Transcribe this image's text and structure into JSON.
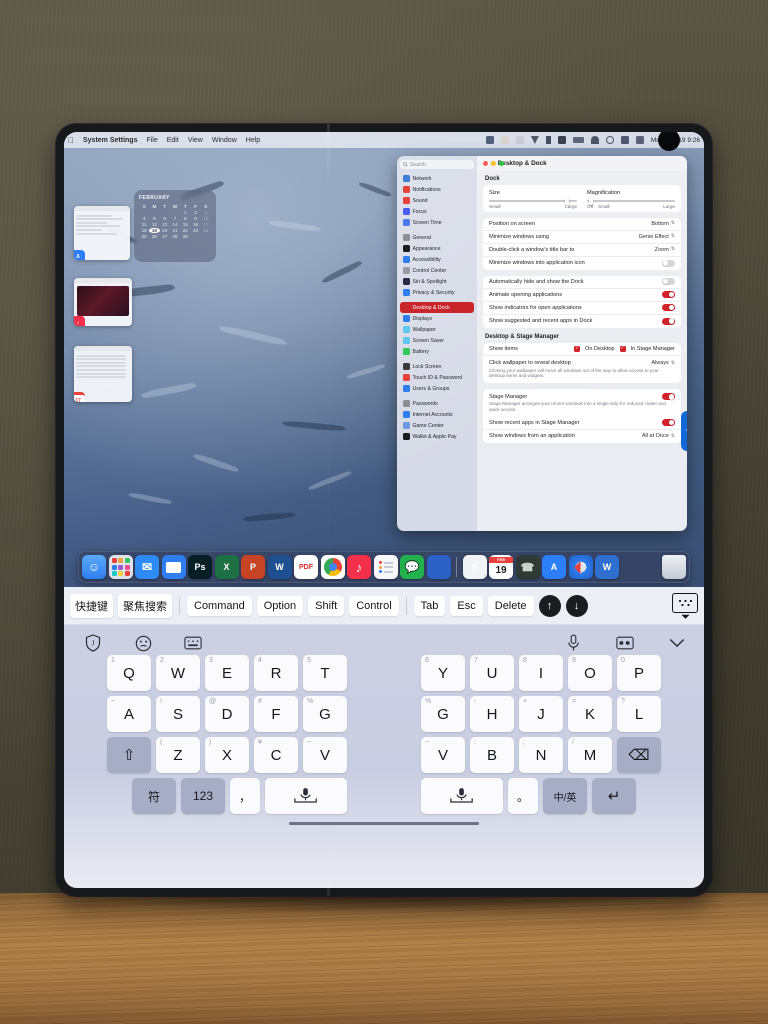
{
  "device": {
    "type": "foldable-phone",
    "surface": "wooden-desk",
    "wall_color": "#514c3c",
    "desk_color": "#a97a44",
    "bezel_color": "#17181a"
  },
  "macos": {
    "accent_color": "#d2232a",
    "wallpaper": "school-of-barracuda-underwater",
    "menubar": {
      "apple_logo": "apple-icon",
      "items": [
        {
          "label": "System Settings",
          "bold": true
        },
        {
          "label": "File",
          "bold": false
        },
        {
          "label": "Edit",
          "bold": false
        },
        {
          "label": "View",
          "bold": false
        },
        {
          "label": "Window",
          "bold": false
        },
        {
          "label": "Help",
          "bold": false
        }
      ],
      "status_icons": [
        "display-icon",
        "dropbox-icon",
        "printer-icon",
        "foxmail-icon",
        "bluetooth-icon",
        "app-icon",
        "battery-icon",
        "wifi-icon",
        "search-icon",
        "input-source-icon",
        "control-center-icon"
      ],
      "clock": "Mon Feb 19  9:26"
    },
    "calendar_widget": {
      "month": "FEBRUARY",
      "dow": [
        "S",
        "M",
        "T",
        "W",
        "T",
        "F",
        "S"
      ],
      "weeks": [
        [
          "",
          "",
          "",
          "",
          "1",
          "2",
          "3"
        ],
        [
          "4",
          "5",
          "6",
          "7",
          "8",
          "9",
          "10"
        ],
        [
          "11",
          "12",
          "13",
          "14",
          "15",
          "16",
          "17"
        ],
        [
          "18",
          "19",
          "20",
          "21",
          "22",
          "23",
          "24"
        ],
        [
          "25",
          "26",
          "27",
          "28",
          "29",
          "",
          ""
        ]
      ],
      "today": "19",
      "dim_days": [
        "3",
        "10",
        "17",
        "24"
      ]
    },
    "stage_manager": [
      {
        "name": "app-store-window",
        "badge": "A",
        "badge_color": "#2d7ff9"
      },
      {
        "name": "music-window",
        "badge": "♪",
        "badge_color": "#f42f4a"
      },
      {
        "name": "calendar-window",
        "badge": "17",
        "badge_color": "#ffffff"
      }
    ],
    "dock": {
      "apps": [
        {
          "name": "finder",
          "label": "",
          "color": "#2f7ef0"
        },
        {
          "name": "launchpad",
          "label": "",
          "color": "#dfe2ea"
        },
        {
          "name": "mail",
          "label": "✉",
          "color": "#2e8bf5"
        },
        {
          "name": "keynote",
          "label": "",
          "color": "#2f7ef0"
        },
        {
          "name": "photoshop",
          "label": "Ps",
          "color": "#061e26"
        },
        {
          "name": "excel",
          "label": "X",
          "color": "#1d7044"
        },
        {
          "name": "powerpoint",
          "label": "P",
          "color": "#c64424"
        },
        {
          "name": "word",
          "label": "W",
          "color": "#1d4f91"
        },
        {
          "name": "pdf-reader",
          "label": "PDF",
          "color": "#d8272c"
        },
        {
          "name": "chrome",
          "label": "",
          "color": "#f5f5f7"
        },
        {
          "name": "music",
          "label": "♪",
          "color": "#f42f4a"
        },
        {
          "name": "reminders",
          "label": "",
          "color": "#f7f7fa"
        },
        {
          "name": "wechat",
          "label": "",
          "color": "#22b14c"
        },
        {
          "name": "activity-app",
          "label": "",
          "color": "#2b60c6"
        }
      ],
      "recent": [
        {
          "name": "foxmail",
          "label": "Y",
          "color": "#f2f3f6"
        },
        {
          "name": "calendar",
          "label": "19",
          "color": "#ffffff"
        },
        {
          "name": "phone",
          "label": "",
          "color": "#2e3a33"
        },
        {
          "name": "app-store",
          "label": "A",
          "color": "#2d7ff9"
        },
        {
          "name": "safari",
          "label": "",
          "color": "#e9eef5"
        },
        {
          "name": "wps-app",
          "label": "W",
          "color": "#2f6fd0"
        }
      ],
      "trash": {
        "name": "trash",
        "label": "",
        "color": "#dfe3ea"
      }
    },
    "settings_window": {
      "title": "Desktop & Dock",
      "traffic_lights": [
        "#ff5f57",
        "#febc2e",
        "#28c840"
      ],
      "back_icon": "chevron-left-icon",
      "forward_icon": "chevron-right-icon",
      "search_placeholder": "Search",
      "sidebar": [
        {
          "label": "Network",
          "color": "#3f7fd6",
          "gap_after": false
        },
        {
          "label": "Notifications",
          "color": "#e8413c",
          "gap_after": false
        },
        {
          "label": "Sound",
          "color": "#e8413c",
          "gap_after": false
        },
        {
          "label": "Focus",
          "color": "#4b5df0",
          "gap_after": false
        },
        {
          "label": "Screen Time",
          "color": "#4b7df0",
          "gap_after": true
        },
        {
          "label": "General",
          "color": "#8e8e93",
          "gap_after": false
        },
        {
          "label": "Appearance",
          "color": "#1c1c1e",
          "gap_after": false
        },
        {
          "label": "Accessibility",
          "color": "#2f7ef0",
          "gap_after": false
        },
        {
          "label": "Control Center",
          "color": "#9a9aa0",
          "gap_after": false
        },
        {
          "label": "Siri & Spotlight",
          "color": "#2a2a46",
          "gap_after": false
        },
        {
          "label": "Privacy & Security",
          "color": "#2f7ef0",
          "gap_after": true
        },
        {
          "label": "Desktop & Dock",
          "color": "#c8262b",
          "active": true,
          "gap_after": false
        },
        {
          "label": "Displays",
          "color": "#2f7ef0",
          "gap_after": false
        },
        {
          "label": "Wallpaper",
          "color": "#5ec8f0",
          "gap_after": false
        },
        {
          "label": "Screen Saver",
          "color": "#5ec8f0",
          "gap_after": false
        },
        {
          "label": "Battery",
          "color": "#34c759",
          "gap_after": true
        },
        {
          "label": "Lock Screen",
          "color": "#3a3a3c",
          "gap_after": false
        },
        {
          "label": "Touch ID & Password",
          "color": "#e8413c",
          "gap_after": false
        },
        {
          "label": "Users & Groups",
          "color": "#2f7ef0",
          "gap_after": true
        },
        {
          "label": "Passwords",
          "color": "#8e8e93",
          "gap_after": false
        },
        {
          "label": "Internet Accounts",
          "color": "#2f7ef0",
          "gap_after": false
        },
        {
          "label": "Game Center",
          "color": "#6d9ae0",
          "gap_after": false
        },
        {
          "label": "Wallet & Apple Pay",
          "color": "#1c1c1e",
          "gap_after": false
        }
      ],
      "dock_section": {
        "title": "Dock",
        "size": {
          "label": "Size",
          "left": "Small",
          "right": "Large",
          "value_pct": 88
        },
        "magnification": {
          "label": "Magnification",
          "off": "Off",
          "left": "Small",
          "right": "Large",
          "value_pct": 4
        },
        "rows": [
          {
            "label": "Position on screen",
            "type": "select",
            "value": "Bottom"
          },
          {
            "label": "Minimize windows using",
            "type": "select",
            "value": "Genie Effect"
          },
          {
            "label": "Double-click a window's title bar to",
            "type": "select",
            "value": "Zoom"
          },
          {
            "label": "Minimize windows into application icon",
            "type": "toggle",
            "on": false
          }
        ],
        "rows2": [
          {
            "label": "Automatically hide and show the Dock",
            "type": "toggle",
            "on": false
          },
          {
            "label": "Animate opening applications",
            "type": "toggle",
            "on": true
          },
          {
            "label": "Show indicators for open applications",
            "type": "toggle",
            "on": true
          },
          {
            "label": "Show suggested and recent apps in Dock",
            "type": "toggle",
            "on": true
          }
        ]
      },
      "stage_section": {
        "title": "Desktop & Stage Manager",
        "show_items": {
          "label": "Show items",
          "checkboxes": [
            {
              "label": "On Desktop",
              "checked": true
            },
            {
              "label": "In Stage Manager",
              "checked": true
            }
          ]
        },
        "click_wallpaper": {
          "label": "Click wallpaper to reveal desktop",
          "value": "Always",
          "description": "Clicking your wallpaper will move all windows out of the way to allow access to your desktop items and widgets."
        },
        "stage_manager": {
          "label": "Stage Manager",
          "on": true,
          "description": "Stage Manager arranges your recent windows into a single strip for reduced clutter and quick access."
        },
        "show_recent": {
          "label": "Show recent apps in Stage Manager",
          "on": true
        },
        "show_windows": {
          "label": "Show windows from an application",
          "value": "All at Once"
        }
      }
    }
  },
  "keyboard": {
    "toolbar": {
      "chinese_keys": [
        "快捷键",
        "聚焦搜索"
      ],
      "modifier_keys": [
        "Command",
        "Option",
        "Shift",
        "Control"
      ],
      "nav_keys": [
        "Tab",
        "Esc",
        "Delete"
      ],
      "arrow_up": "↑",
      "arrow_down": "↓",
      "dismiss_icon": "hide-keyboard-icon"
    },
    "top_icons_left": [
      "jovi-shield-icon",
      "emoji-icon",
      "keyboard-settings-icon"
    ],
    "top_icons_right": [
      "microphone-icon",
      "clipboard-icon",
      "chevron-down-icon"
    ],
    "rows": [
      {
        "left": [
          {
            "key": "Q",
            "sup": "1"
          },
          {
            "key": "W",
            "sup": "2"
          },
          {
            "key": "E",
            "sup": "3"
          },
          {
            "key": "R",
            "sup": "4"
          },
          {
            "key": "T",
            "sup": "5"
          }
        ],
        "right": [
          {
            "key": "Y",
            "sup": "6"
          },
          {
            "key": "U",
            "sup": "7"
          },
          {
            "key": "I",
            "sup": "8"
          },
          {
            "key": "O",
            "sup": "9"
          },
          {
            "key": "P",
            "sup": "0"
          }
        ]
      },
      {
        "left": [
          {
            "key": "A",
            "sup": "~"
          },
          {
            "key": "S",
            "sup": "!"
          },
          {
            "key": "D",
            "sup": "@"
          },
          {
            "key": "F",
            "sup": "#"
          },
          {
            "key": "G",
            "sup": "%"
          }
        ],
        "right": [
          {
            "key": "G",
            "sup": "%"
          },
          {
            "key": "H",
            "sup": "-"
          },
          {
            "key": "J",
            "sup": "+"
          },
          {
            "key": "K",
            "sup": "="
          },
          {
            "key": "L",
            "sup": "?"
          }
        ]
      },
      {
        "left": [
          {
            "key": "⇧",
            "sup": "",
            "fn": true
          },
          {
            "key": "Z",
            "sup": "("
          },
          {
            "key": "X",
            "sup": ")"
          },
          {
            "key": "C",
            "sup": "¥"
          },
          {
            "key": "V",
            "sup": "~"
          }
        ],
        "right": [
          {
            "key": "V",
            "sup": "~"
          },
          {
            "key": "B",
            "sup": ":"
          },
          {
            "key": "N",
            "sup": ";"
          },
          {
            "key": "M",
            "sup": "/"
          },
          {
            "key": "⌫",
            "sup": "",
            "fn": true
          }
        ]
      }
    ],
    "bottom_row": {
      "left": [
        {
          "key": "符",
          "fn": true
        },
        {
          "key": "123",
          "fn": true
        },
        {
          "key": "，",
          "punct": true
        },
        {
          "key": "space-mic-left",
          "space": true
        }
      ],
      "right": [
        {
          "key": "space-mic-right",
          "space": true
        },
        {
          "key": "。",
          "punct": true
        },
        {
          "key": "中/英",
          "fn": true
        },
        {
          "key": "↵",
          "fn": true
        }
      ]
    }
  }
}
